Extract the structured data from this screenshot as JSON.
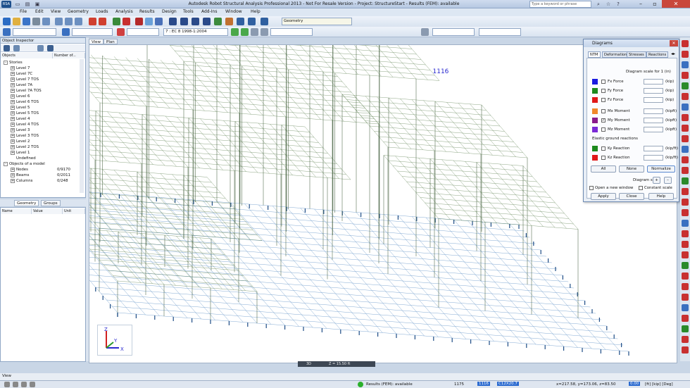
{
  "window": {
    "title": "Autodesk Robot Structural Analysis Professional 2013 - Not For Resale Version - Project: StructureStart - Results (FEM): available",
    "search_placeholder": "Type a keyword or phrase",
    "app_badge": "RSA"
  },
  "menu": [
    "File",
    "Edit",
    "View",
    "Geometry",
    "Loads",
    "Analysis",
    "Results",
    "Design",
    "Tools",
    "Add-Ins",
    "Window",
    "Help"
  ],
  "toolbar": {
    "load_case": "7 : EC 8 1998-1:2004",
    "layout": "Geometry"
  },
  "inspector": {
    "title": "Object Inspector",
    "col_objects": "Objects",
    "col_number": "Number of...",
    "tree": [
      {
        "label": "Stories",
        "level": 0,
        "exp": "-"
      },
      {
        "label": "Level 7",
        "level": 1,
        "exp": "+"
      },
      {
        "label": "Level 7C",
        "level": 1,
        "exp": "+"
      },
      {
        "label": "Level 7 TOS",
        "level": 1,
        "exp": "+"
      },
      {
        "label": "Level 7A",
        "level": 1,
        "exp": "+"
      },
      {
        "label": "Level 7A TOS",
        "level": 1,
        "exp": "+"
      },
      {
        "label": "Level 6",
        "level": 1,
        "exp": "+"
      },
      {
        "label": "Level 6 TOS",
        "level": 1,
        "exp": "+"
      },
      {
        "label": "Level 5",
        "level": 1,
        "exp": "+"
      },
      {
        "label": "Level 5 TOS",
        "level": 1,
        "exp": "+"
      },
      {
        "label": "Level 4",
        "level": 1,
        "exp": "+"
      },
      {
        "label": "Level 4 TOS",
        "level": 1,
        "exp": "+"
      },
      {
        "label": "Level 3",
        "level": 1,
        "exp": "+"
      },
      {
        "label": "Level 3 TOS",
        "level": 1,
        "exp": "+"
      },
      {
        "label": "Level 2",
        "level": 1,
        "exp": "+"
      },
      {
        "label": "Level 2 TOS",
        "level": 1,
        "exp": "+"
      },
      {
        "label": "Level 1",
        "level": 1,
        "exp": "+"
      },
      {
        "label": "Undefined",
        "level": 1,
        "exp": ""
      },
      {
        "label": "Objects of a model",
        "level": 0,
        "exp": "-"
      },
      {
        "label": "Nodes",
        "level": 1,
        "exp": "+",
        "count": "0/9170"
      },
      {
        "label": "Beams",
        "level": 1,
        "exp": "+",
        "count": "0/2011"
      },
      {
        "label": "Columns",
        "level": 1,
        "exp": "+",
        "count": "0/248"
      }
    ],
    "tabs": [
      "Geometry",
      "Groups"
    ],
    "props_cols": [
      "Name",
      "Value",
      "Unit"
    ]
  },
  "view_tabs": [
    "View",
    "Plan"
  ],
  "viewport": {
    "node_label": "1116",
    "mode": "3D",
    "z_level": "Z = 15.50 ft"
  },
  "diagrams": {
    "title": "Diagrams",
    "tabs": [
      "NTM",
      "Deformation",
      "Stresses",
      "Reactions"
    ],
    "scale_label": "Diagram scale for 1",
    "scale_unit": "(in)",
    "rows": [
      {
        "label": "Fx Force",
        "unit": "(kip)",
        "color": "#1a1ae0",
        "checked": false
      },
      {
        "label": "Fy Force",
        "unit": "(kip)",
        "color": "#1d8a1d",
        "checked": false
      },
      {
        "label": "Fz Force",
        "unit": "(kip)",
        "color": "#e01818",
        "checked": false
      },
      {
        "label": "Mx Moment",
        "unit": "(kipft)",
        "color": "#f0882a",
        "checked": false
      },
      {
        "label": "My Moment",
        "unit": "(kipft)",
        "color": "#8a1a8a",
        "checked": true
      },
      {
        "label": "Mz Moment",
        "unit": "(kipft)",
        "color": "#7a2ad6",
        "checked": false
      }
    ],
    "elastic_label": "Elastic ground reactions",
    "elastic_rows": [
      {
        "label": "Ky Reaction",
        "unit": "(kip/ft)",
        "color": "#1d8a1d"
      },
      {
        "label": "Kz Reaction",
        "unit": "(kip/ft)",
        "color": "#e01818"
      }
    ],
    "btn_all": "All",
    "btn_none": "None",
    "btn_normalize": "Normalize",
    "size_label": "Diagram size:",
    "open_new": "Open a new window",
    "constant_scale": "Constant scale",
    "btn_apply": "Apply",
    "btn_close": "Close",
    "btn_help": "Help"
  },
  "statusbar": {
    "results": "Results (FEM): available",
    "nodes": "1175",
    "num2": "1116",
    "section": "C12X20.7",
    "coords": "x=217.58, y=173.06, z=83.50",
    "zoom": "0.00",
    "units": "[ft] [kip] [Deg]"
  },
  "view_strip": "View"
}
